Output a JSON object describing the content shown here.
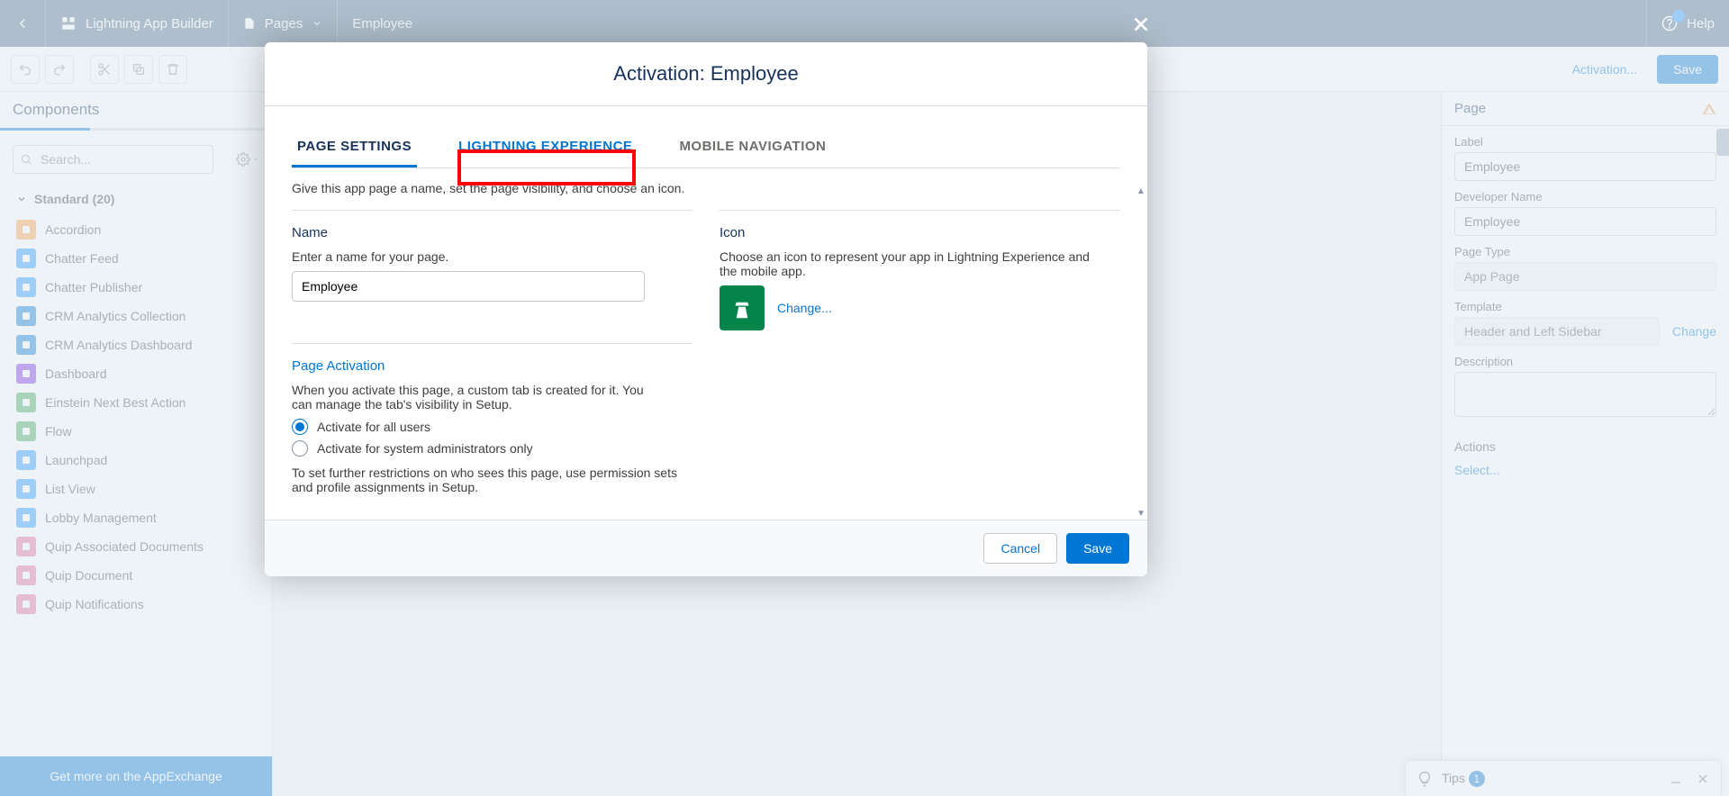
{
  "header": {
    "appTitle": "Lightning App Builder",
    "pagesLabel": "Pages",
    "pageName": "Employee",
    "helpLabel": "Help"
  },
  "toolbar": {
    "activationLabel": "Activation...",
    "saveLabel": "Save"
  },
  "sidebar": {
    "title": "Components",
    "searchPlaceholder": "Search...",
    "groupLabel": "Standard (20)",
    "items": [
      {
        "label": "Accordion",
        "color": "#ff9a3c"
      },
      {
        "label": "Chatter Feed",
        "color": "#1b96ff"
      },
      {
        "label": "Chatter Publisher",
        "color": "#1b96ff"
      },
      {
        "label": "CRM Analytics Collection",
        "color": "#0176d3"
      },
      {
        "label": "CRM Analytics Dashboard",
        "color": "#0176d3"
      },
      {
        "label": "Dashboard",
        "color": "#7526e3"
      },
      {
        "label": "Einstein Next Best Action",
        "color": "#3ba755"
      },
      {
        "label": "Flow",
        "color": "#3ba755"
      },
      {
        "label": "Launchpad",
        "color": "#1b96ff"
      },
      {
        "label": "List View",
        "color": "#1b96ff"
      },
      {
        "label": "Lobby Management",
        "color": "#1b96ff"
      },
      {
        "label": "Quip Associated Documents",
        "color": "#e56798"
      },
      {
        "label": "Quip Document",
        "color": "#e56798"
      },
      {
        "label": "Quip Notifications",
        "color": "#e56798"
      }
    ],
    "appExchangeLabel": "Get more on the AppExchange"
  },
  "rightPanel": {
    "title": "Page",
    "labelField": {
      "label": "Label",
      "value": "Employee"
    },
    "devNameField": {
      "label": "Developer Name",
      "value": "Employee"
    },
    "pageTypeField": {
      "label": "Page Type",
      "value": "App Page"
    },
    "templateField": {
      "label": "Template",
      "value": "Header and Left Sidebar",
      "changeLabel": "Change"
    },
    "descriptionField": {
      "label": "Description"
    },
    "actionsLabel": "Actions",
    "selectLabel": "Select..."
  },
  "modal": {
    "title": "Activation: Employee",
    "tabs": [
      "PAGE SETTINGS",
      "LIGHTNING EXPERIENCE",
      "MOBILE NAVIGATION"
    ],
    "intro": "Give this app page a name, set the page visibility, and choose an icon.",
    "nameSection": {
      "title": "Name",
      "help": "Enter a name for your page.",
      "value": "Employee"
    },
    "iconSection": {
      "title": "Icon",
      "help": "Choose an icon to represent your app in Lightning Experience and the mobile app.",
      "changeLabel": "Change..."
    },
    "activationSection": {
      "title": "Page Activation",
      "help": "When you activate this page, a custom tab is created for it. You can manage the tab's visibility in Setup.",
      "radio1": "Activate for all users",
      "radio2": "Activate for system administrators only",
      "footnote": "To set further restrictions on who sees this page, use permission sets and profile assignments in Setup."
    },
    "cancelLabel": "Cancel",
    "saveLabel": "Save"
  },
  "tips": {
    "label": "Tips",
    "count": "1"
  }
}
